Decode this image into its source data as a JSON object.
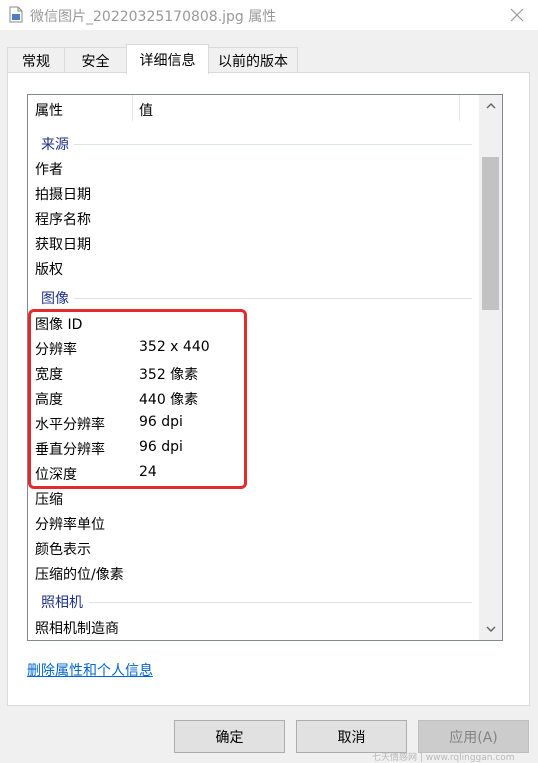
{
  "window": {
    "title": "微信图片_20220325170808.jpg 属性"
  },
  "tabs": [
    {
      "label": "常规"
    },
    {
      "label": "安全"
    },
    {
      "label": "详细信息"
    },
    {
      "label": "以前的版本"
    }
  ],
  "active_tab": "详细信息",
  "list": {
    "columns": [
      "属性",
      "值"
    ],
    "groups": [
      {
        "label": "来源",
        "rows": [
          {
            "name": "作者",
            "value": ""
          },
          {
            "name": "拍摄日期",
            "value": ""
          },
          {
            "name": "程序名称",
            "value": ""
          },
          {
            "name": "获取日期",
            "value": ""
          },
          {
            "name": "版权",
            "value": ""
          }
        ]
      },
      {
        "label": "图像",
        "rows": [
          {
            "name": "图像 ID",
            "value": ""
          },
          {
            "name": "分辨率",
            "value": "352 x 440"
          },
          {
            "name": "宽度",
            "value": "352 像素"
          },
          {
            "name": "高度",
            "value": "440 像素"
          },
          {
            "name": "水平分辨率",
            "value": "96 dpi"
          },
          {
            "name": "垂直分辨率",
            "value": "96 dpi"
          },
          {
            "name": "位深度",
            "value": "24"
          },
          {
            "name": "压缩",
            "value": ""
          },
          {
            "name": "分辨率单位",
            "value": ""
          },
          {
            "name": "颜色表示",
            "value": ""
          },
          {
            "name": "压缩的位/像素",
            "value": ""
          }
        ]
      },
      {
        "label": "照相机",
        "rows": [
          {
            "name": "照相机制造商",
            "value": ""
          }
        ]
      }
    ]
  },
  "link": {
    "label": "删除属性和个人信息"
  },
  "buttons": {
    "ok": "确定",
    "cancel": "取消",
    "apply": "应用(A)"
  },
  "watermark": "七天情感网 | www.rqlinggan.com",
  "colors": {
    "highlight": "#e32b2b",
    "group_header": "#1e3287",
    "link": "#0066cc"
  },
  "icons": [
    "file-icon",
    "close-icon",
    "scroll-up-icon",
    "scroll-down-icon"
  ]
}
